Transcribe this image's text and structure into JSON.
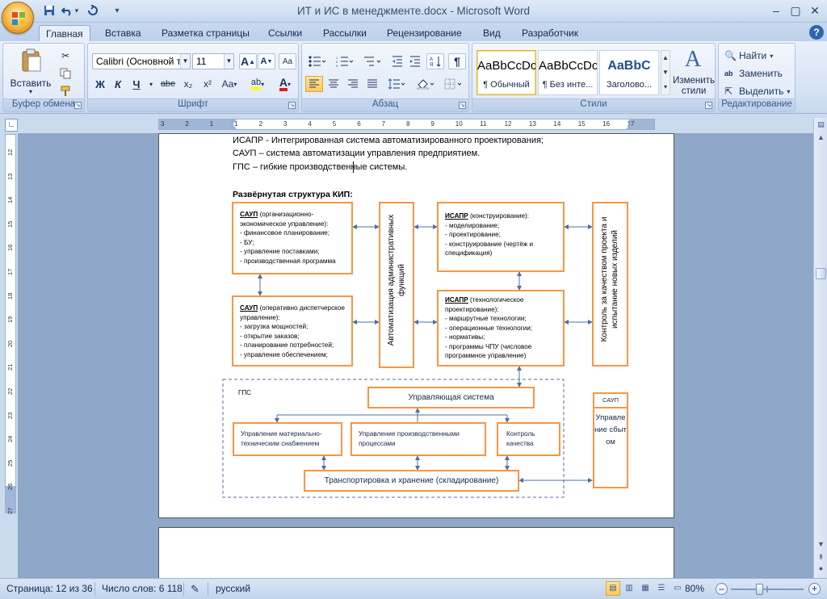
{
  "window": {
    "title": "ИТ и ИС в менеджменте.docx - Microsoft Word",
    "minimize": "–",
    "maximize": "▢",
    "close": "✕"
  },
  "qat": {
    "save_icon": "save-icon",
    "undo_icon": "undo-icon",
    "redo_icon": "redo-icon",
    "customize": "▾"
  },
  "tabs": [
    {
      "label": "Главная",
      "active": true
    },
    {
      "label": "Вставка"
    },
    {
      "label": "Разметка страницы"
    },
    {
      "label": "Ссылки"
    },
    {
      "label": "Рассылки"
    },
    {
      "label": "Рецензирование"
    },
    {
      "label": "Вид"
    },
    {
      "label": "Разработчик"
    }
  ],
  "help": "?",
  "ribbon": {
    "clipboard": {
      "label": "Буфер обмена",
      "paste": "Вставить"
    },
    "font": {
      "label": "Шрифт",
      "font_name": "Calibri (Основной те",
      "font_size": "11",
      "grow": "A",
      "shrink": "A",
      "clear": "Aa",
      "bold": "Ж",
      "italic": "К",
      "underline": "Ч",
      "strike": "abe",
      "subscript": "x₂",
      "superscript": "x²",
      "case": "Aa",
      "highlight": "ab",
      "font_color": "A"
    },
    "paragraph": {
      "label": "Абзац"
    },
    "styles": {
      "label": "Стили",
      "items": [
        {
          "sample": "AaBbCcDc",
          "name": "¶ Обычный",
          "selected": true
        },
        {
          "sample": "AaBbCcDc",
          "name": "¶ Без инте..."
        },
        {
          "sample": "AaBbC",
          "name": "Заголово..."
        }
      ],
      "change": "Изменить стили"
    },
    "editing": {
      "label": "Редактирование",
      "find": "Найти",
      "replace": "Заменить",
      "select": "Выделить"
    }
  },
  "ruler": {
    "h_numbers": [
      "3",
      "2",
      "1",
      "1",
      "2",
      "3",
      "4",
      "5",
      "6",
      "7",
      "8",
      "9",
      "10",
      "11",
      "12",
      "13",
      "14",
      "15",
      "16",
      "17"
    ],
    "v_numbers": [
      "12",
      "13",
      "14",
      "15",
      "16",
      "17",
      "18",
      "19",
      "20",
      "21",
      "22",
      "23",
      "24",
      "25",
      "26",
      "27"
    ]
  },
  "document": {
    "lines": [
      "ИСАПР - Интегрированная система автоматизированного проектирования;",
      "САУП – система автоматизации управления предприятием.",
      "ГПС – гибкие производственные системы."
    ],
    "heading": "Развёрнутая структура КИП:",
    "diagram": {
      "saup1": {
        "title": "САУП",
        "rest": " (организационно-экономическое управление):",
        "items": [
          "- финансовое планирование;",
          "- БУ;",
          "- управление поставками;",
          "- производственная программа"
        ]
      },
      "saup2": {
        "title": "САУП",
        "rest": " (оперативно диспетчерское управление):",
        "items": [
          "- загрузка мощностей;",
          "- открытие заказов;",
          "- планирование потребностей;",
          "- управление обеспечением;"
        ]
      },
      "admin": "Автоматизация административных функций",
      "isapr1": {
        "title": "ИСАПР",
        "rest": " (конструирование):",
        "items": [
          "- моделирование;",
          "- проектирование;",
          "- конструирование (чертёж и спецификация)"
        ]
      },
      "isapr2": {
        "title": "ИСАПР",
        "rest": " (технологическое проектирование):",
        "items": [
          "- маршрутные технологии;",
          "- операционные технологии;",
          "- нормативы;",
          "- программы ЧПУ (числовое программное управление)"
        ]
      },
      "quality_control": "Контроль за качеством проекта и испытание новых изделий",
      "gps_label": "ГПС",
      "control_system": "Управляющая система",
      "material_supply": "Управление материально-техническим снабжением",
      "production_processes": "Управление производственными процессами",
      "quality": "Контроль качества",
      "transport": "Транспортировка и хранение (складирование)",
      "saup3_title": "САУП",
      "saup3_text": "Управление сбытом"
    }
  },
  "status": {
    "page": "Страница: 12 из 36",
    "words": "Число слов: 6 118",
    "language": "русский",
    "zoom": "80%",
    "zoom_out": "–",
    "zoom_in": "+"
  }
}
